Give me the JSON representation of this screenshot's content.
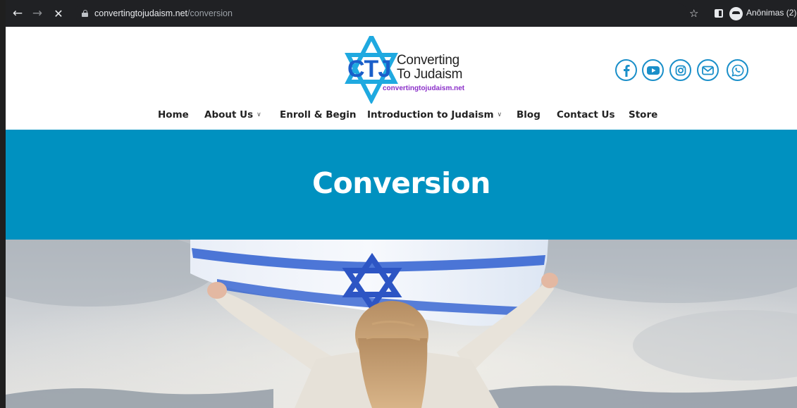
{
  "browser": {
    "url_host": "convertingtojudaism.net",
    "url_path": "/conversion",
    "profile_label": "Anônimas (2)"
  },
  "logo": {
    "monogram": "CTJ",
    "line1": "Converting",
    "line2": "To Judaism",
    "site_url": "convertingtojudaism.net"
  },
  "social": {
    "accent_color": "#1a8fc9",
    "icons": [
      "facebook-icon",
      "youtube-icon",
      "instagram-icon",
      "email-icon",
      "whatsapp-icon"
    ]
  },
  "nav": {
    "items": [
      {
        "label": "Home"
      },
      {
        "label": "About Us",
        "has_dropdown": true
      },
      {
        "label": "Enroll & Begin"
      },
      {
        "label": "Introduction to Judaism",
        "has_dropdown": true
      },
      {
        "label": "Blog"
      },
      {
        "label": "Contact Us"
      },
      {
        "label": "Store"
      }
    ]
  },
  "hero": {
    "title": "Conversion",
    "background_color": "#0091c0"
  },
  "photo": {
    "subject": "girl holding Israeli flag overhead"
  }
}
